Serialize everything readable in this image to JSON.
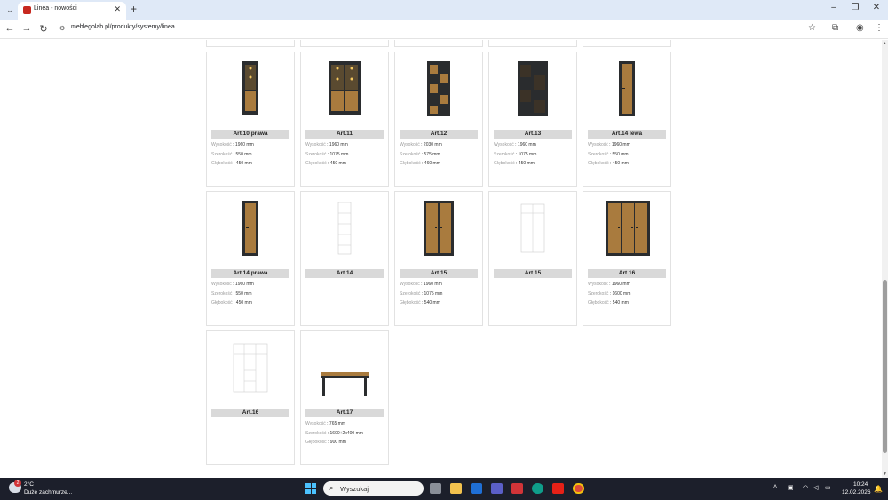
{
  "browser": {
    "tab_title": "Linea - nowości",
    "url": "meblegolab.pl/produkty/systemy/linea"
  },
  "products": [
    {
      "name": "Art.10 prawa",
      "image": "tall-cabinet-with-lights",
      "specs": [
        {
          "label": "Wysokość",
          "value": "1960 mm"
        },
        {
          "label": "Szerokość",
          "value": "550 mm"
        },
        {
          "label": "Głębokość",
          "value": "450 mm"
        }
      ]
    },
    {
      "name": "Art.11",
      "image": "double-glass-cabinet",
      "specs": [
        {
          "label": "Wysokość",
          "value": "1960 mm"
        },
        {
          "label": "Szerokość",
          "value": "1075 mm"
        },
        {
          "label": "Głębokość",
          "value": "450 mm"
        }
      ]
    },
    {
      "name": "Art.12",
      "image": "zigzag-shelf",
      "specs": [
        {
          "label": "Wysokość",
          "value": "2030 mm"
        },
        {
          "label": "Szerokość",
          "value": "575 mm"
        },
        {
          "label": "Głębokość",
          "value": "460 mm"
        }
      ]
    },
    {
      "name": "Art.13",
      "image": "wide-open-shelf",
      "specs": [
        {
          "label": "Wysokość",
          "value": "1960 mm"
        },
        {
          "label": "Szerokość",
          "value": "1075 mm"
        },
        {
          "label": "Głębokość",
          "value": "450 mm"
        }
      ]
    },
    {
      "name": "Art.14 lewa",
      "image": "tall-narrow-wardrobe",
      "specs": [
        {
          "label": "Wysokość",
          "value": "1960 mm"
        },
        {
          "label": "Szerokość",
          "value": "550 mm"
        },
        {
          "label": "Głębokość",
          "value": "450 mm"
        }
      ]
    },
    {
      "name": "Art.14 prawa",
      "image": "tall-narrow-wardrobe",
      "specs": [
        {
          "label": "Wysokość",
          "value": "1960 mm"
        },
        {
          "label": "Szerokość",
          "value": "550 mm"
        },
        {
          "label": "Głębokość",
          "value": "450 mm"
        }
      ]
    },
    {
      "name": "Art.14",
      "image": "line-drawing-narrow",
      "specs": []
    },
    {
      "name": "Art.15",
      "image": "double-wardrobe",
      "specs": [
        {
          "label": "Wysokość",
          "value": "1960 mm"
        },
        {
          "label": "Szerokość",
          "value": "1075 mm"
        },
        {
          "label": "Głębokość",
          "value": "540 mm"
        }
      ]
    },
    {
      "name": "Art.15",
      "image": "line-drawing-double",
      "specs": []
    },
    {
      "name": "Art.16",
      "image": "triple-wardrobe",
      "specs": [
        {
          "label": "Wysokość",
          "value": "1960 mm"
        },
        {
          "label": "Szerokość",
          "value": "1600 mm"
        },
        {
          "label": "Głębokość",
          "value": "540 mm"
        }
      ]
    },
    {
      "name": "Art.16",
      "image": "line-drawing-triple",
      "specs": []
    },
    {
      "name": "Art.17",
      "image": "dining-table",
      "specs": [
        {
          "label": "Wysokość",
          "value": "765 mm"
        },
        {
          "label": "Szerokość",
          "value": "1600+2x400 mm"
        },
        {
          "label": "Głębokość",
          "value": "900 mm"
        }
      ]
    }
  ],
  "taskbar": {
    "temp": "2°C",
    "weather": "Duże zachmurze...",
    "weather_badge": "2",
    "search_placeholder": "Wyszukaj",
    "time": "10:24",
    "date": "12.02.2026"
  },
  "colors": {
    "wood": "#a97b3e",
    "dark_frame": "#2a2c2e",
    "label_bg": "#d9d9d9"
  }
}
